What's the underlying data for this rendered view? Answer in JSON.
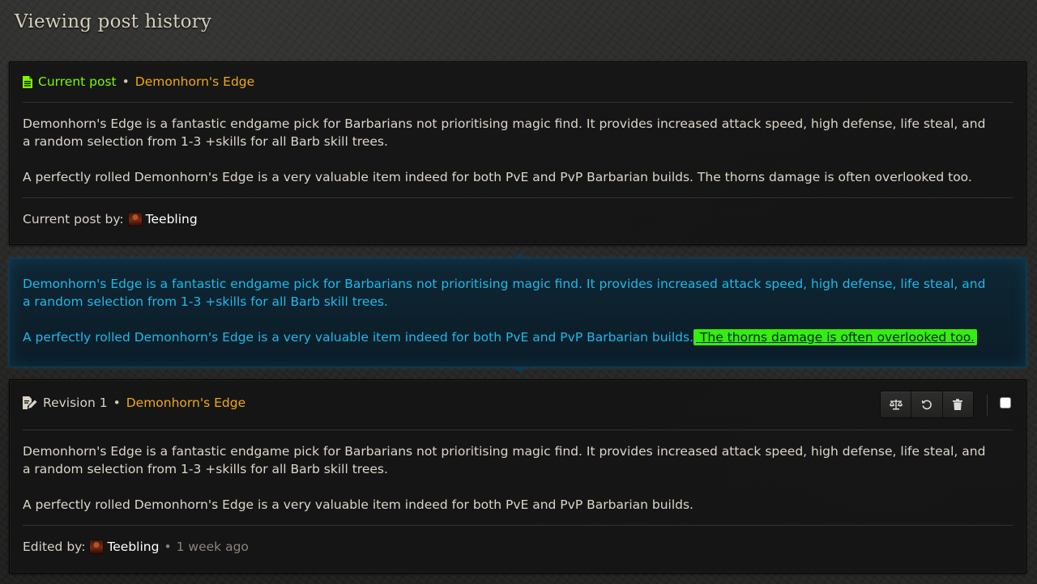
{
  "page": {
    "title": "Viewing post history"
  },
  "current": {
    "label": "Current post",
    "separator": "•",
    "item_name": "Demonhorn's Edge",
    "paragraph1": "Demonhorn's Edge is a fantastic endgame pick for Barbarians not prioritising magic find. It provides increased attack speed, high defense, life steal, and a random selection from 1-3 +skills for all Barb skill trees.",
    "paragraph2": "A perfectly rolled Demonhorn's Edge is a very valuable item indeed for both PvE and PvP Barbarian builds. The thorns damage is often overlooked too.",
    "byline_label": "Current post by:",
    "author": "Teebling"
  },
  "diff": {
    "paragraph1": "Demonhorn's Edge is a fantastic endgame pick for Barbarians not prioritising magic find. It provides increased attack speed, high defense, life steal, and a random selection from 1-3 +skills for all Barb skill trees.",
    "paragraph2_unchanged": "A perfectly rolled Demonhorn's Edge is a very valuable item indeed for both PvE and PvP Barbarian builds.",
    "paragraph2_added": " The thorns damage is often overlooked too.",
    "colors": {
      "text": "#1fb9ea",
      "added_bg": "#33ee10"
    }
  },
  "revision": {
    "label": "Revision 1",
    "separator": "•",
    "item_name": "Demonhorn's Edge",
    "paragraph1": "Demonhorn's Edge is a fantastic endgame pick for Barbarians not prioritising magic find. It provides increased attack speed, high defense, life steal, and a random selection from 1-3 +skills for all Barb skill trees.",
    "paragraph2": "A perfectly rolled Demonhorn's Edge is a very valuable item indeed for both PvE and PvP Barbarian builds.",
    "byline_label": "Edited by:",
    "author": "Teebling",
    "time_separator": "•",
    "time": "1 week ago",
    "buttons": [
      {
        "icon": "balance-scale-icon"
      },
      {
        "icon": "undo-icon"
      },
      {
        "icon": "trash-icon"
      }
    ]
  },
  "colors": {
    "accent_green": "#7cfa00",
    "item_orange": "#f0a814",
    "diff_blue": "#1fb9ea"
  }
}
